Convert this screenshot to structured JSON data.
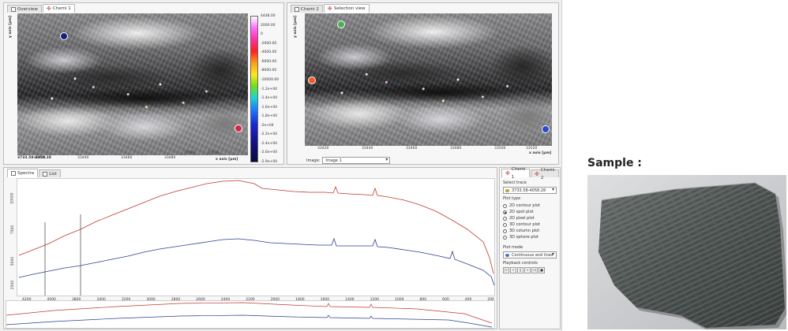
{
  "overview": {
    "tabs": [
      {
        "label": "Overview"
      },
      {
        "label": "Chemi 1"
      }
    ],
    "coord_readout": "3733.58-4058.28",
    "x_ticks": [
      "33420",
      "33440",
      "33460",
      "33480",
      "33500",
      "33520"
    ],
    "x_axis_label": "x axis [µm]",
    "colorbar_labels": [
      "4448.00",
      "2000.00",
      "0",
      "-2000.00",
      "-4000.00",
      "-6000.00",
      "-8000.00",
      "-10000.00",
      "-1.2e+04",
      "-1.4e+04",
      "-1.6e+04",
      "-1.8e+04",
      "-2e+04",
      "-2.2e+04",
      "-2.4e+04",
      "-2.6e+04",
      "-2.9e+04"
    ],
    "marker_colors": {
      "top_left": "#1a1f7a",
      "bottom_right": "#d4254a"
    }
  },
  "selection": {
    "tabs": [
      {
        "label": "Chemi 2"
      },
      {
        "label": "Selection view"
      }
    ],
    "x_ticks": [
      "33420",
      "33440",
      "33460",
      "33480",
      "33500",
      "33520"
    ],
    "x_axis_label": "x axis [µm]",
    "image_label": "Image:",
    "image_value": "Image 1",
    "marker_colors": {
      "top": "#4caf50",
      "left": "#f05a24",
      "bottom_right": "#2a4cc9"
    }
  },
  "spectra": {
    "tabs": [
      {
        "label": "Spectra"
      },
      {
        "label": "List"
      }
    ],
    "y_ticks": [
      "10000",
      "7500",
      "5000",
      "2500"
    ],
    "x_ticks": [
      "4200",
      "4000",
      "3800",
      "3400",
      "3200",
      "3000",
      "2800",
      "2600",
      "2400",
      "2200",
      "2000",
      "1800",
      "1600",
      "1400",
      "1200",
      "1000",
      "800",
      "600",
      "400",
      "200"
    ],
    "series_colors": {
      "red": "#c0392b",
      "blue": "#2c3e8f"
    }
  },
  "controls": {
    "tabs": [
      {
        "label": "Chemi 1"
      },
      {
        "label": "Chemi 2"
      }
    ],
    "select_trace_label": "Select trace",
    "trace_value": "3733.58-4058.28",
    "plot_type_label": "Plot type",
    "plot_types": [
      "2D contour plot",
      "2D spot plot",
      "2D pixel plot",
      "3D contour plot",
      "3D column plot",
      "3D sphere plot"
    ],
    "plot_type_selected": 1,
    "plot_mode_label": "Plot mode",
    "plot_mode_value": "Continuous and lines",
    "playback_label": "Playback controls",
    "playback_buttons": [
      "|<",
      "<",
      "||",
      ">",
      ">|",
      "■"
    ]
  },
  "sample": {
    "title": "Sample :"
  }
}
